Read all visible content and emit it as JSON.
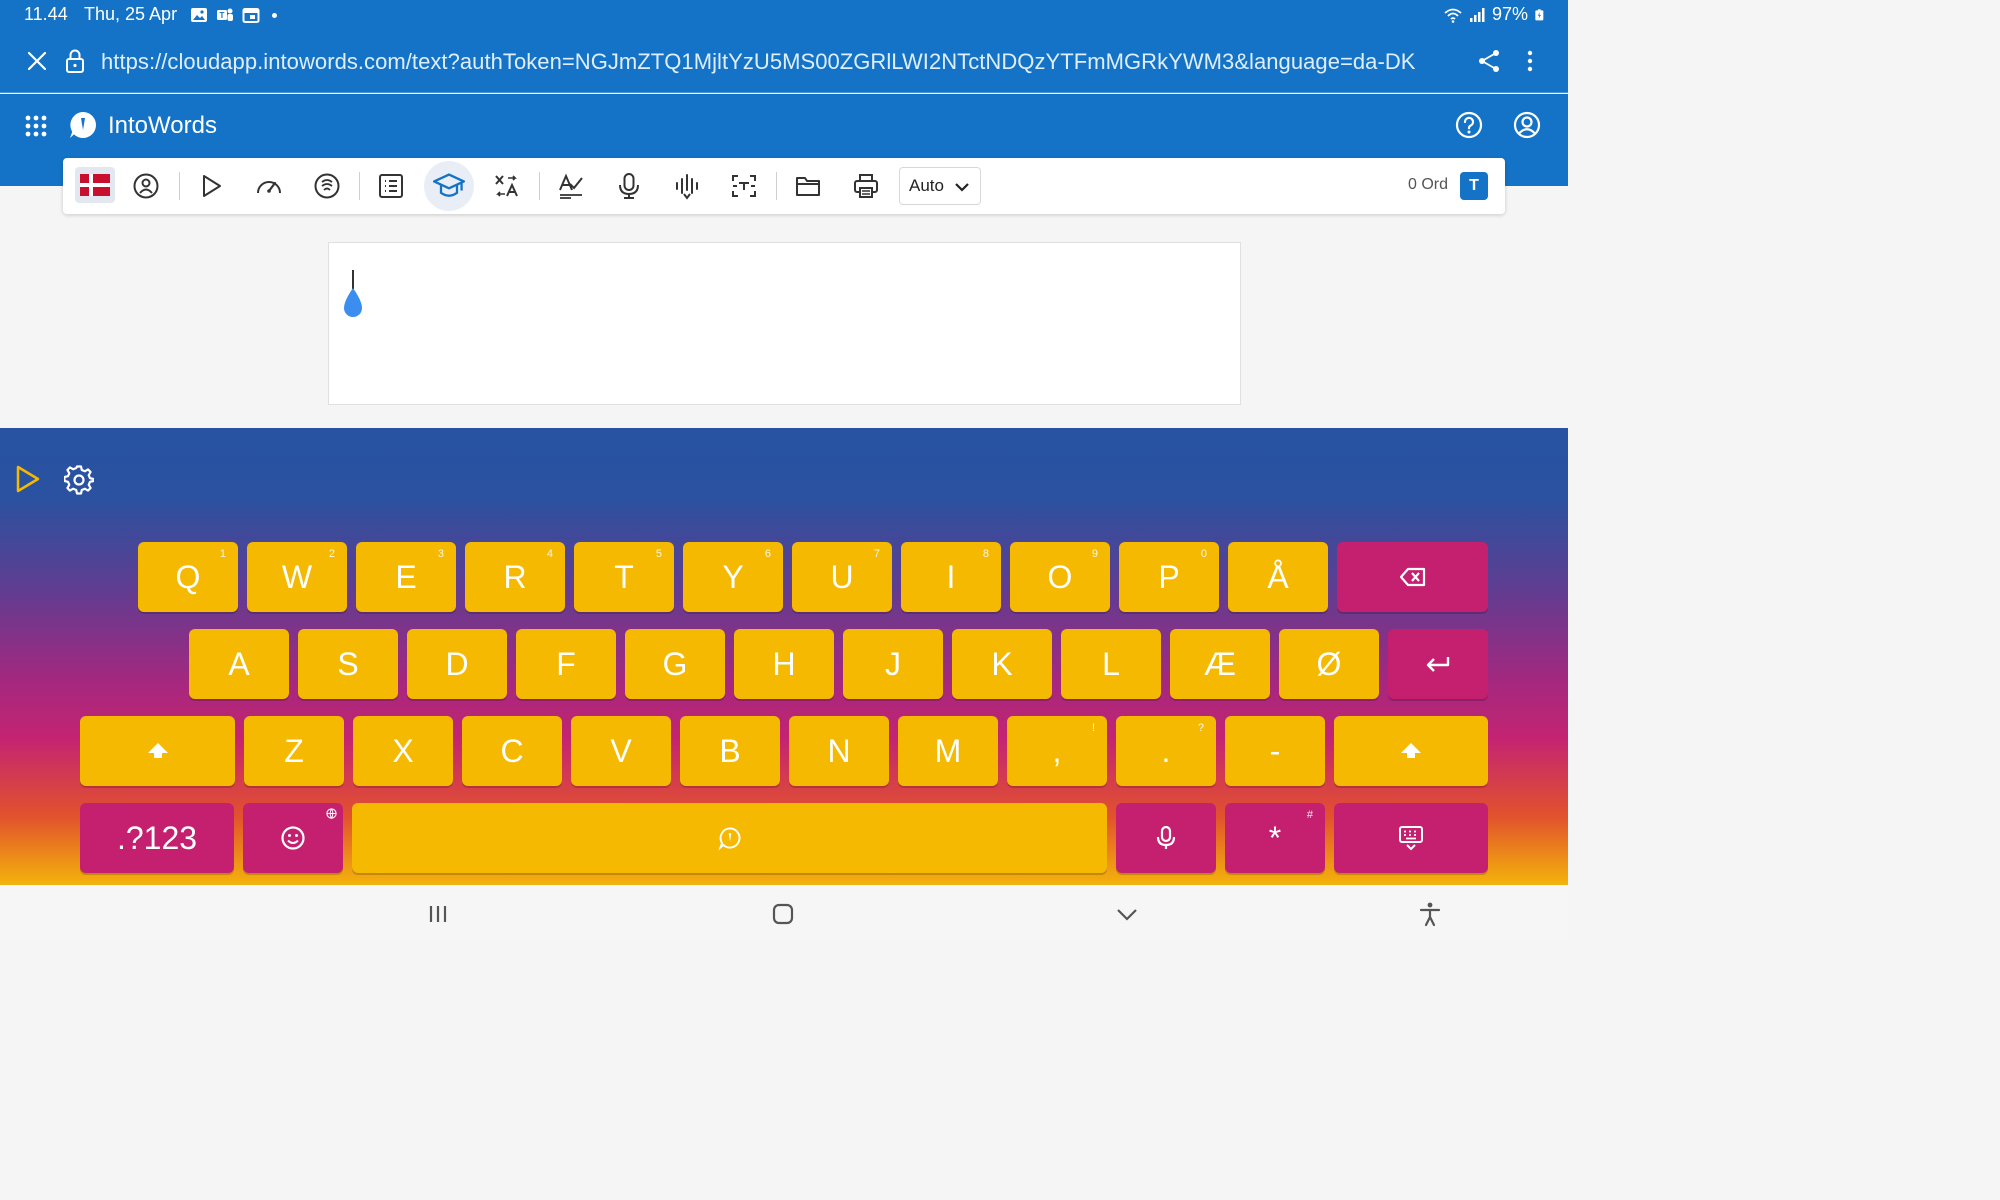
{
  "status_bar": {
    "time": "11.44",
    "date": "Thu, 25 Apr",
    "battery": "97%",
    "icons": [
      "gallery-icon",
      "teams-icon",
      "calendar-icon",
      "notification-dot-icon",
      "wifi-icon",
      "signal-icon",
      "battery-charging-icon"
    ]
  },
  "browser": {
    "url": "https://cloudapp.intowords.com/text?authToken=NGJmZTQ1MjltYzU5MS00ZGRlLWI2NTctNDQzYTFmMGRkYWM3&language=da-DK",
    "icons": [
      "close-icon",
      "lock-icon",
      "share-icon",
      "more-vert-icon"
    ]
  },
  "app": {
    "title": "IntoWords",
    "icons": [
      "apps-grid-icon",
      "intowords-logo-icon",
      "help-icon",
      "account-icon"
    ]
  },
  "toolbar": {
    "language": "da-DK",
    "voice_speed": "Auto",
    "word_count": "0 Ord",
    "badge": "T",
    "accent_color": "#1473c6",
    "tools": [
      "danish-flag-icon",
      "voice-icon",
      "play-icon",
      "speed-icon",
      "read-aloud-icon",
      "list-icon",
      "education-icon",
      "translate-icon",
      "spellcheck-icon",
      "microphone-icon",
      "audio-wave-icon",
      "text-scan-icon",
      "folder-icon",
      "print-icon"
    ]
  },
  "keyboard": {
    "key_color": "#f4b900",
    "function_key_color": "#c4206f",
    "row1": [
      {
        "label": "Q",
        "hint": "1"
      },
      {
        "label": "W",
        "hint": "2"
      },
      {
        "label": "E",
        "hint": "3"
      },
      {
        "label": "R",
        "hint": "4"
      },
      {
        "label": "T",
        "hint": "5"
      },
      {
        "label": "Y",
        "hint": "6"
      },
      {
        "label": "U",
        "hint": "7"
      },
      {
        "label": "I",
        "hint": "8"
      },
      {
        "label": "O",
        "hint": "9"
      },
      {
        "label": "P",
        "hint": "0"
      },
      {
        "label": "Å",
        "hint": ""
      }
    ],
    "row2": [
      "A",
      "S",
      "D",
      "F",
      "G",
      "H",
      "J",
      "K",
      "L",
      "Æ",
      "Ø"
    ],
    "row3": [
      {
        "label": "Z",
        "hint": ""
      },
      {
        "label": "X",
        "hint": ""
      },
      {
        "label": "C",
        "hint": ""
      },
      {
        "label": "V",
        "hint": ""
      },
      {
        "label": "B",
        "hint": ""
      },
      {
        "label": "N",
        "hint": ""
      },
      {
        "label": "M",
        "hint": ""
      },
      {
        "label": ",",
        "hint": "!"
      },
      {
        "label": ".",
        "hint": "?"
      },
      {
        "label": "-",
        "hint": ""
      }
    ],
    "symbols_label": ".?123",
    "star_label": "*",
    "star_hint": "#",
    "icons": [
      "keyboard-play-icon",
      "settings-gear-icon",
      "backspace-icon",
      "enter-icon",
      "shift-icon",
      "emoji-icon",
      "globe-icon",
      "space-logo-icon",
      "keyboard-mic-icon",
      "hide-keyboard-icon"
    ]
  },
  "navbar": {
    "icons": [
      "recent-apps-icon",
      "home-icon",
      "back-chevron-icon",
      "accessibility-icon"
    ]
  }
}
